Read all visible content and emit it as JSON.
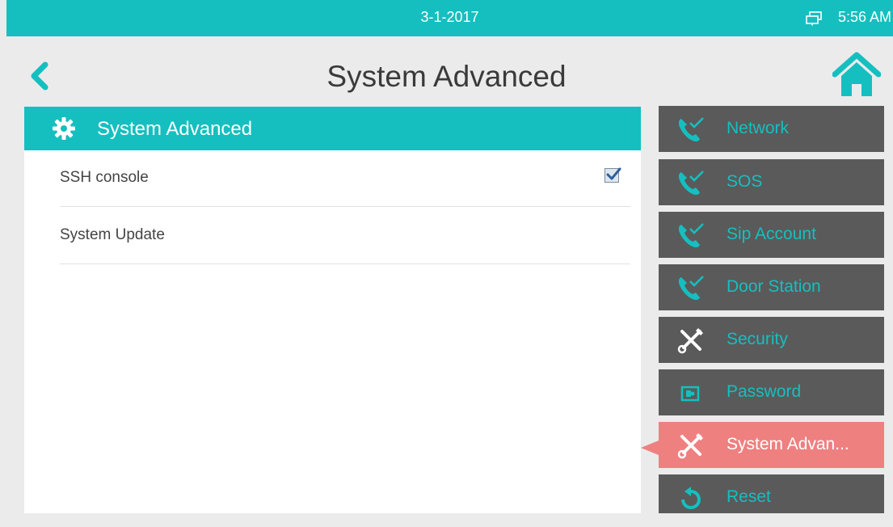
{
  "statusbar": {
    "date": "3-1-2017",
    "time": "5:56 AM",
    "network_icon": "network-icon"
  },
  "header": {
    "title": "System Advanced",
    "back_icon": "chevron-left-icon",
    "home_icon": "home-icon"
  },
  "panel": {
    "title": "System Advanced",
    "icon": "gear-icon",
    "rows": [
      {
        "label": "SSH console",
        "checked": true
      },
      {
        "label": "System Update"
      }
    ]
  },
  "menu": {
    "items": [
      {
        "label": "Network",
        "icon": "phone-check-icon"
      },
      {
        "label": "SOS",
        "icon": "phone-check-icon"
      },
      {
        "label": "Sip Account",
        "icon": "phone-check-icon"
      },
      {
        "label": "Door Station",
        "icon": "phone-check-icon"
      },
      {
        "label": "Security",
        "icon": "tools-icon"
      },
      {
        "label": "Password",
        "icon": "password-icon"
      },
      {
        "label": "System Advan...",
        "icon": "tools-icon",
        "active": true
      },
      {
        "label": "Reset",
        "icon": "reset-icon"
      }
    ]
  },
  "colors": {
    "accent": "#15bfc0",
    "menu_bg": "#5a5a5a",
    "active": "#ef8080",
    "background": "#ebebeb"
  }
}
